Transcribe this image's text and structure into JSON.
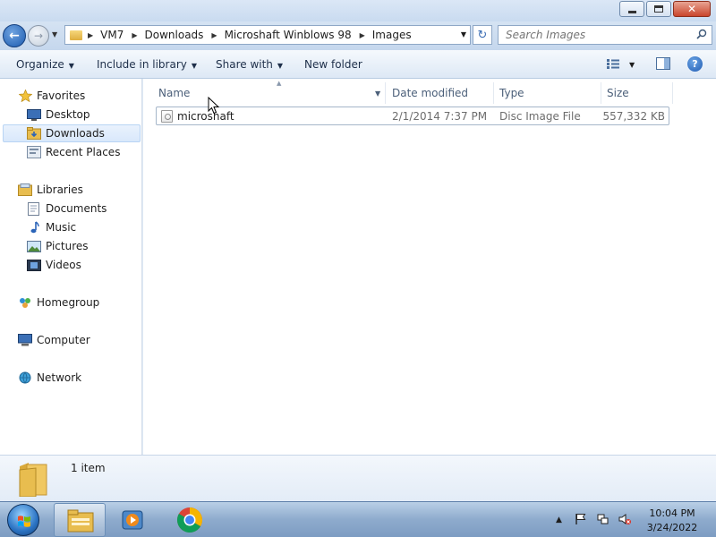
{
  "window": {
    "controls": {
      "minimize_icon": "minimize-icon",
      "maximize_icon": "maximize-icon",
      "close_label": "✕"
    }
  },
  "address": {
    "breadcrumbs": [
      "VM7",
      "Downloads",
      "Microshaft Winblows 98",
      "Images"
    ],
    "search_placeholder": "Search Images"
  },
  "toolbar": {
    "organize": "Organize",
    "include_in_library": "Include in library",
    "share_with": "Share with",
    "new_folder": "New folder",
    "help_label": "?"
  },
  "nav": {
    "favorites": {
      "label": "Favorites",
      "items": [
        "Desktop",
        "Downloads",
        "Recent Places"
      ]
    },
    "libraries": {
      "label": "Libraries",
      "items": [
        "Documents",
        "Music",
        "Pictures",
        "Videos"
      ]
    },
    "homegroup": "Homegroup",
    "computer": "Computer",
    "network": "Network",
    "selected": "Downloads"
  },
  "columns": [
    "Name",
    "Date modified",
    "Type",
    "Size"
  ],
  "files": [
    {
      "name": "microshaft",
      "date_modified": "2/1/2014 7:37 PM",
      "type": "Disc Image File",
      "size": "557,332 KB"
    }
  ],
  "details": {
    "item_count": "1 item"
  },
  "taskbar": {
    "apps": [
      "windows-explorer",
      "media-player",
      "chrome"
    ],
    "clock_time": "10:04 PM",
    "clock_date": "3/24/2022"
  },
  "colors": {
    "selection": "#d9e8fb",
    "accent": "#1f5bb3",
    "folder": "#e8bd4f"
  }
}
